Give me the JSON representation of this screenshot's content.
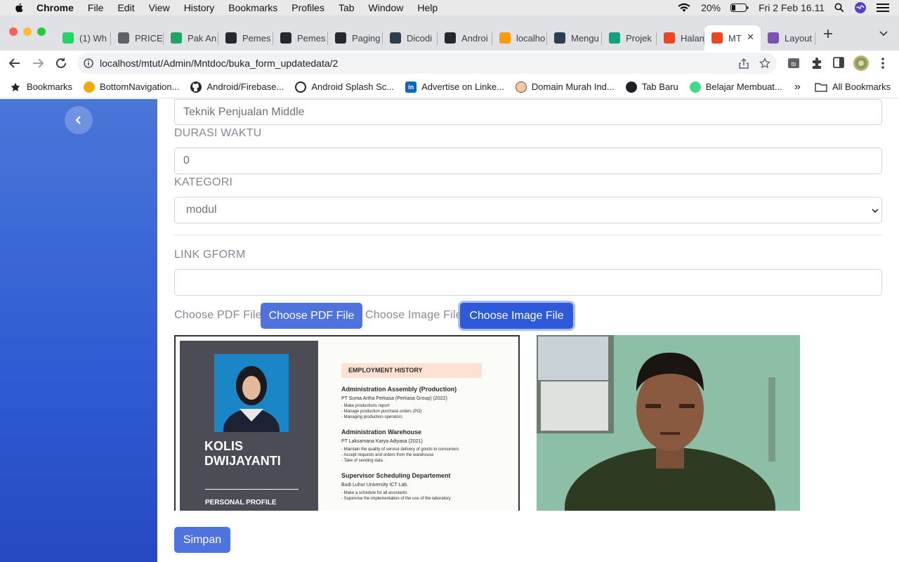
{
  "menubar": {
    "app_name": "Chrome",
    "items": [
      "File",
      "Edit",
      "View",
      "History",
      "Bookmarks",
      "Profiles",
      "Tab",
      "Window",
      "Help"
    ],
    "battery": "20%",
    "datetime": "Fri 2 Feb  16.11"
  },
  "tabs": [
    {
      "label": "(1) Wh",
      "icon": "whatsapp-icon",
      "color": "#25d366"
    },
    {
      "label": "PRICE",
      "icon": "globe-icon",
      "color": "#5f6368"
    },
    {
      "label": "Pak An",
      "icon": "drive-icon",
      "color": "#1fa463"
    },
    {
      "label": "Pemes",
      "icon": "github-icon",
      "color": "#24292f"
    },
    {
      "label": "Pemes",
      "icon": "github-icon",
      "color": "#24292f"
    },
    {
      "label": "Paging",
      "icon": "github-icon",
      "color": "#24292f"
    },
    {
      "label": "Dicodi",
      "icon": "dicoding-icon",
      "color": "#2d3e50"
    },
    {
      "label": "Androi",
      "icon": "github-icon",
      "color": "#24292f"
    },
    {
      "label": "localho",
      "icon": "phpmyadmin-icon",
      "color": "#f89c0e"
    },
    {
      "label": "Mengu",
      "icon": "dicoding-icon",
      "color": "#2d3e50"
    },
    {
      "label": "Projek",
      "icon": "chatgpt-icon",
      "color": "#10a37f"
    },
    {
      "label": "Halam",
      "icon": "codeigniter-icon",
      "color": "#ee4623"
    },
    {
      "label": "MT",
      "icon": "codeigniter-icon",
      "color": "#ee4623",
      "active": true
    },
    {
      "label": "Layout",
      "icon": "bootstrap-icon",
      "color": "#7952b3"
    }
  ],
  "address_bar": {
    "url": "localhost/mtut/Admin/Mntdoc/buka_form_updatedata/2"
  },
  "bookmarks": [
    {
      "label": "Bookmarks",
      "icon": "star-icon"
    },
    {
      "label": "BottomNavigation...",
      "icon": "favicon-icon"
    },
    {
      "label": "Android/Firebase...",
      "icon": "github-icon"
    },
    {
      "label": "Android Splash Sc...",
      "icon": "favicon-icon"
    },
    {
      "label": "Advertise on Linke...",
      "icon": "linkedin-icon"
    },
    {
      "label": "Domain Murah Ind...",
      "icon": "favicon-icon"
    },
    {
      "label": "Tab Baru",
      "icon": "favicon-icon"
    },
    {
      "label": "Belajar Membuat...",
      "icon": "android-icon"
    }
  ],
  "bookmarks_overflow": "»",
  "all_bookmarks": "All Bookmarks",
  "form": {
    "title_value": "Teknik Penjualan Middle",
    "durasi_label": "DURASI WAKTU",
    "durasi_value": "0",
    "kategori_label": "KATEGORI",
    "kategori_value": "modul",
    "gform_label": "LINK GFORM",
    "gform_value": "",
    "pdf_label": "Choose PDF File",
    "pdf_button": "Choose PDF File",
    "image_label": "Choose Image File",
    "image_button": "Choose Image File",
    "submit": "Simpan"
  },
  "pdf_preview": {
    "name": "KOLIS\nDWIJAYANTI",
    "name_line1": "KOLIS",
    "name_line2": "DWIJAYANTI",
    "profile_heading": "PERSONAL PROFILE",
    "history_heading": "EMPLOYMENT HISTORY",
    "jobs": [
      {
        "title": "Administration Assembly (Production)",
        "company": "PT Suma Artha Perkasa (Perkasa Group) (2022)",
        "bullets": [
          "- Make productions report",
          "- Manage production purchase orders (PO)",
          "- Managing production operators"
        ]
      },
      {
        "title": "Administration Warehouse",
        "company": "PT Laksamana Karya Adiyasa (2021)",
        "bullets": [
          "- Maintain the quality of service delivery of goods to consumers",
          "- Accept requests and orders from the warehouse",
          "- Take of sending data"
        ]
      },
      {
        "title": "Supervisor Scheduling Departement",
        "company": "Budi Luhur University ICT Lab.",
        "bullets": [
          "- Make a schedule for all assistants",
          "- Supervise the implementation of the use of the laboratory"
        ]
      }
    ]
  },
  "colors": {
    "primary": "#4e73df",
    "sidebar": "#2f5bd3"
  }
}
